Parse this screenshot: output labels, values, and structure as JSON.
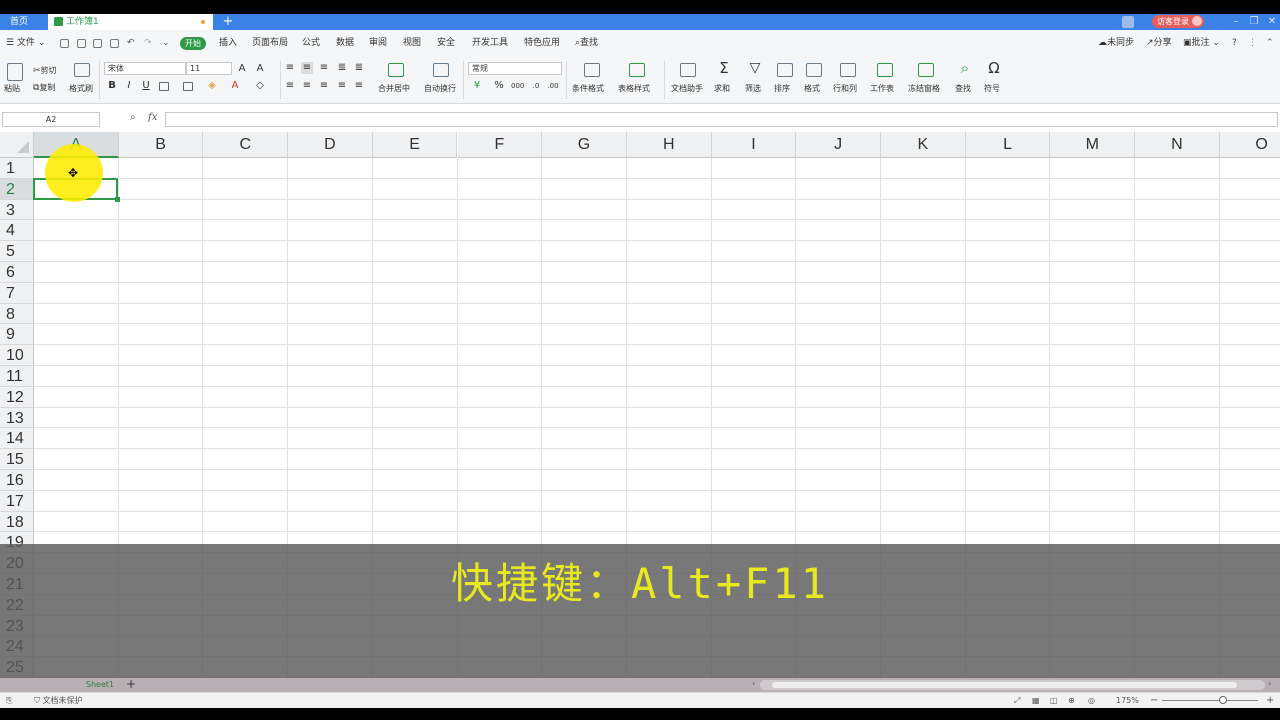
{
  "titlebar": {
    "home_tab": "首页",
    "workbook_tab": "工作簿1",
    "new_tab": "+",
    "login": "访客登录"
  },
  "menubar": {
    "file": "文件",
    "tabs": [
      {
        "label": "开始",
        "active": true
      },
      {
        "label": "插入"
      },
      {
        "label": "页面布局"
      },
      {
        "label": "公式"
      },
      {
        "label": "数据"
      },
      {
        "label": "审阅"
      },
      {
        "label": "视图"
      },
      {
        "label": "安全"
      },
      {
        "label": "开发工具"
      },
      {
        "label": "特色应用"
      }
    ],
    "search": "查找",
    "sync": "未同步",
    "share": "分享",
    "comment": "批注",
    "help": "?"
  },
  "ribbon": {
    "paste": "粘贴",
    "cut": "剪切",
    "copy": "复制",
    "format_painter": "格式刷",
    "font_name": "宋体",
    "font_size": "11",
    "merge_center": "合并居中",
    "wrap_text": "自动换行",
    "number_format": "常规",
    "conditional_format": "条件格式",
    "table_style": "表格样式",
    "doc_assistant": "文档助手",
    "sum": "求和",
    "filter": "筛选",
    "sort": "排序",
    "format": "格式",
    "row_col": "行和列",
    "worksheet": "工作表",
    "freeze": "冻结窗格",
    "find": "查找",
    "symbol": "符号"
  },
  "formula_bar": {
    "name_box": "A2",
    "fx": "fx",
    "value": ""
  },
  "grid": {
    "columns": [
      "A",
      "B",
      "C",
      "D",
      "E",
      "F",
      "G",
      "H",
      "I",
      "J",
      "K",
      "L",
      "M",
      "N",
      "O"
    ],
    "rows": [
      "1",
      "2",
      "3",
      "4",
      "5",
      "6",
      "7",
      "8",
      "9",
      "10",
      "11",
      "12",
      "13",
      "14",
      "15",
      "16",
      "17",
      "18",
      "19",
      "20",
      "21",
      "22",
      "23",
      "24",
      "25"
    ],
    "selected_cell": "A2"
  },
  "subtitle": "快捷键：Alt+F11",
  "sheets": {
    "tabs": [
      "Sheet1"
    ],
    "add": "+"
  },
  "statusbar": {
    "protect": "文档未保护",
    "zoom": "175%",
    "minus": "−",
    "plus": "+"
  },
  "colors": {
    "accent": "#2e9a48",
    "titlebar": "#3a82e6",
    "login_badge": "#e45d5d",
    "cursor_highlight": "#ffec00",
    "subtitle_text": "#e8e81e"
  }
}
